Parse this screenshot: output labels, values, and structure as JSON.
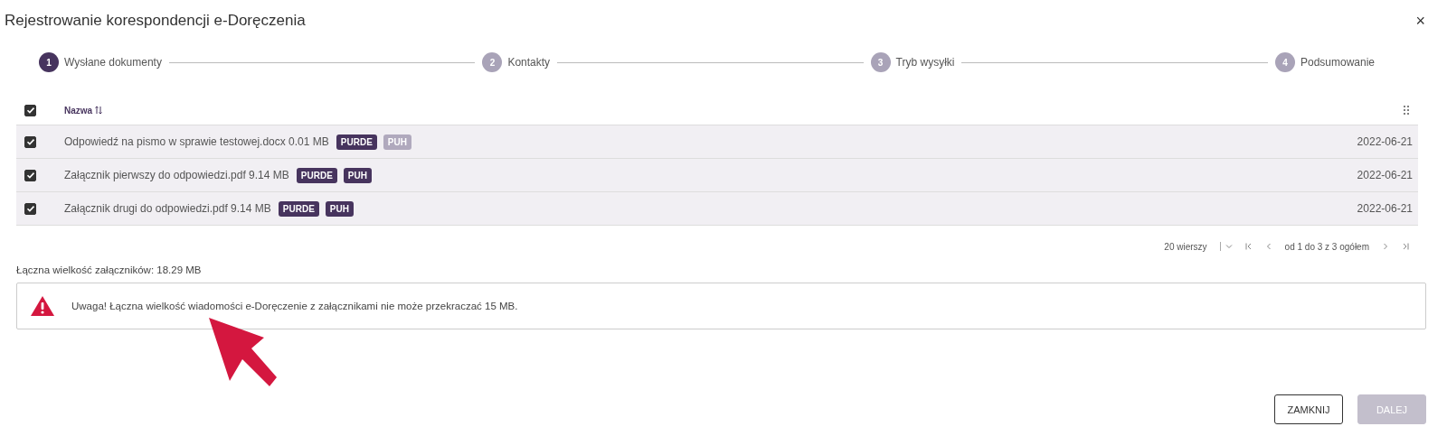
{
  "window": {
    "title": "Rejestrowanie korespondencji e-Doręczenia",
    "close": "×"
  },
  "steps": [
    {
      "number": "1",
      "label": "Wysłane dokumenty",
      "selected": true
    },
    {
      "number": "2",
      "label": "Kontakty",
      "selected": false
    },
    {
      "number": "3",
      "label": "Tryb wysyłki",
      "selected": false
    },
    {
      "number": "4",
      "label": "Podsumowanie",
      "selected": false
    }
  ],
  "table": {
    "select_all_checked": true,
    "columns": [
      {
        "label": "Nazwa"
      }
    ],
    "rows": [
      {
        "checked": true,
        "name": "Odpowiedź na pismo w sprawie testowej.docx 0.01 MB",
        "tags": [
          {
            "label": "PURDE",
            "disabled": false
          },
          {
            "label": "PUH",
            "disabled": true
          }
        ],
        "date": "2022-06-21"
      },
      {
        "checked": true,
        "name": "Załącznik pierwszy do odpowiedzi.pdf 9.14 MB",
        "tags": [
          {
            "label": "PURDE",
            "disabled": false
          },
          {
            "label": "PUH",
            "disabled": false
          }
        ],
        "date": "2022-06-21"
      },
      {
        "checked": true,
        "name": "Załącznik drugi do odpowiedzi.pdf 9.14 MB",
        "tags": [
          {
            "label": "PURDE",
            "disabled": false
          },
          {
            "label": "PUH",
            "disabled": false
          }
        ],
        "date": "2022-06-21"
      }
    ]
  },
  "pager": {
    "rows_per_page": "20 wierszy",
    "range": "od 1 do 3 z 3 ogółem"
  },
  "total_size": "Łączna wielkość załączników: 18.29 MB",
  "alert": {
    "kind": "warning",
    "message": "Uwaga! Łączna wielkość wiadomości e-Doręczenie z załącznikami nie może przekraczać 15 MB."
  },
  "buttons": [
    {
      "label": "ZAMKNIJ",
      "disabled": false
    },
    {
      "label": "DALEJ",
      "disabled": true
    }
  ]
}
